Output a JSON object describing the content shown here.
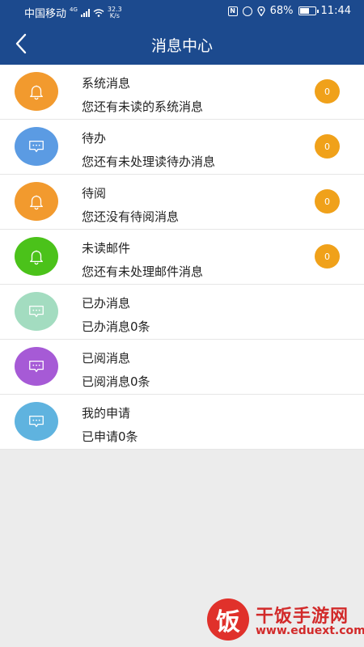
{
  "status_bar": {
    "carrier": "中国移动",
    "network_type": "4G",
    "speed_value": "32.3",
    "speed_unit": "K/s",
    "battery": "68%",
    "battery_level": 0.68,
    "time": "11:44",
    "icons": [
      "signal-icon",
      "wifi-icon",
      "nfc-icon",
      "alarm-icon",
      "location-icon",
      "battery-icon"
    ]
  },
  "header": {
    "back_icon": "chevron-left-icon",
    "title": "消息中心"
  },
  "messages": [
    {
      "icon": "bell-icon",
      "color": "#f29a2e",
      "title": "系统消息",
      "subtitle": "您还有未读的系统消息",
      "badge": "0"
    },
    {
      "icon": "chat-icon",
      "color": "#5b9be3",
      "title": "待办",
      "subtitle": "您还有未处理读待办消息",
      "badge": "0"
    },
    {
      "icon": "bell-icon",
      "color": "#f29a2e",
      "title": "待阅",
      "subtitle": "您还没有待阅消息",
      "badge": "0"
    },
    {
      "icon": "bell-icon",
      "color": "#4bc21a",
      "title": "未读邮件",
      "subtitle": "您还有未处理邮件消息",
      "badge": "0"
    },
    {
      "icon": "chat-icon",
      "color": "#a3dcc0",
      "title": "已办消息",
      "subtitle": "已办消息0条"
    },
    {
      "icon": "chat-icon",
      "color": "#a65ad6",
      "title": "已阅消息",
      "subtitle": "已阅消息0条"
    },
    {
      "icon": "chat-icon",
      "color": "#5fb3df",
      "title": "我的申请",
      "subtitle": "已申请0条"
    }
  ],
  "badge_color": "#f0a11a",
  "header_color": "#1c4a8e",
  "watermark": {
    "logo_char": "饭",
    "name": "干饭手游网",
    "url": "www.eduext.com"
  }
}
